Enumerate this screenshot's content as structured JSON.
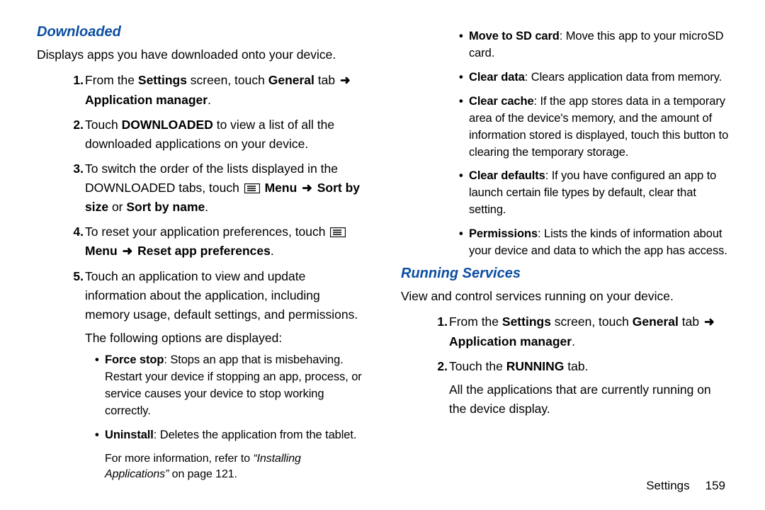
{
  "left": {
    "heading": "Downloaded",
    "intro": "Displays apps you have downloaded onto your device.",
    "step1_a": "From the ",
    "step1_b": "Settings",
    "step1_c": " screen, touch ",
    "step1_d": "General",
    "step1_e": " tab ",
    "step1_f": "Application manager",
    "step1_g": ".",
    "step2_a": "Touch ",
    "step2_b": "DOWNLOADED",
    "step2_c": " to view a list of all the downloaded applications on your device.",
    "step3_a": "To switch the order of the lists displayed in the DOWNLOADED tabs, touch ",
    "step3_b": "Menu",
    "step3_c": "Sort by size",
    "step3_d": " or ",
    "step3_e": "Sort by name",
    "step3_f": ".",
    "step4_a": "To reset your application preferences, touch ",
    "step4_b": "Menu",
    "step4_c": "Reset app preferences",
    "step4_d": ".",
    "step5": "Touch an application to view and update information about the application, including memory usage, default settings, and permissions.",
    "lead": "The following options are displayed:",
    "b1_a": "Force stop",
    "b1_b": ": Stops an app that is misbehaving. Restart your device if stopping an app, process, or service causes your device to stop working correctly.",
    "b2_a": "Uninstall",
    "b2_b": ": Deletes the application from the tablet.",
    "note_a": "For more information, refer to ",
    "note_b": "“Installing Applications”",
    "note_c": " on page 121."
  },
  "right_top": {
    "b1_a": "Move to SD card",
    "b1_b": ": Move this app to your microSD card.",
    "b2_a": "Clear data",
    "b2_b": ": Clears application data from memory.",
    "b3_a": "Clear cache",
    "b3_b": ": If the app stores data in a temporary area of the device's memory, and the amount of information stored is displayed, touch this button to clearing the temporary storage.",
    "b4_a": "Clear defaults",
    "b4_b": ": If you have configured an app to launch certain file types by default, clear that setting.",
    "b5_a": "Permissions",
    "b5_b": ": Lists the kinds of information about your device and data to which the app has access."
  },
  "right": {
    "heading": "Running Services",
    "intro": "View and control services running on your device.",
    "step1_a": "From the ",
    "step1_b": "Settings",
    "step1_c": " screen, touch ",
    "step1_d": "General",
    "step1_e": " tab ",
    "step1_f": "Application manager",
    "step1_g": ".",
    "step2_a": "Touch the ",
    "step2_b": "RUNNING",
    "step2_c": " tab.",
    "after": "All the applications that are currently running on the device display."
  },
  "footer": {
    "section": "Settings",
    "page": "159"
  },
  "glyphs": {
    "arrow": "➜"
  }
}
